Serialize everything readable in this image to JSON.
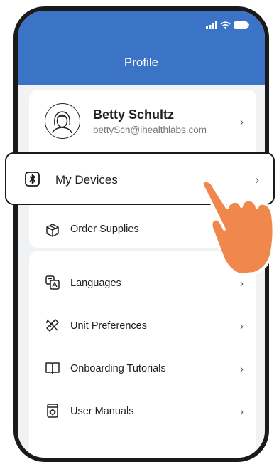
{
  "header": {
    "title": "Profile"
  },
  "profile": {
    "name": "Betty Schultz",
    "email": "bettySch@ihealthlabs.com"
  },
  "account_items": [
    {
      "label": "My Devices",
      "icon": "bluetooth-icon"
    },
    {
      "label": "Order Supplies",
      "icon": "box-icon"
    }
  ],
  "settings_items": [
    {
      "label": "Languages",
      "icon": "translate-icon"
    },
    {
      "label": "Unit Preferences",
      "icon": "ruler-pencil-icon"
    },
    {
      "label": "Onboarding Tutorials",
      "icon": "book-icon"
    },
    {
      "label": "User Manuals",
      "icon": "manual-icon"
    }
  ],
  "chevron": "›",
  "colors": {
    "header": "#3b74c6",
    "background": "#f1f2f4",
    "hand": "#f0884d"
  }
}
